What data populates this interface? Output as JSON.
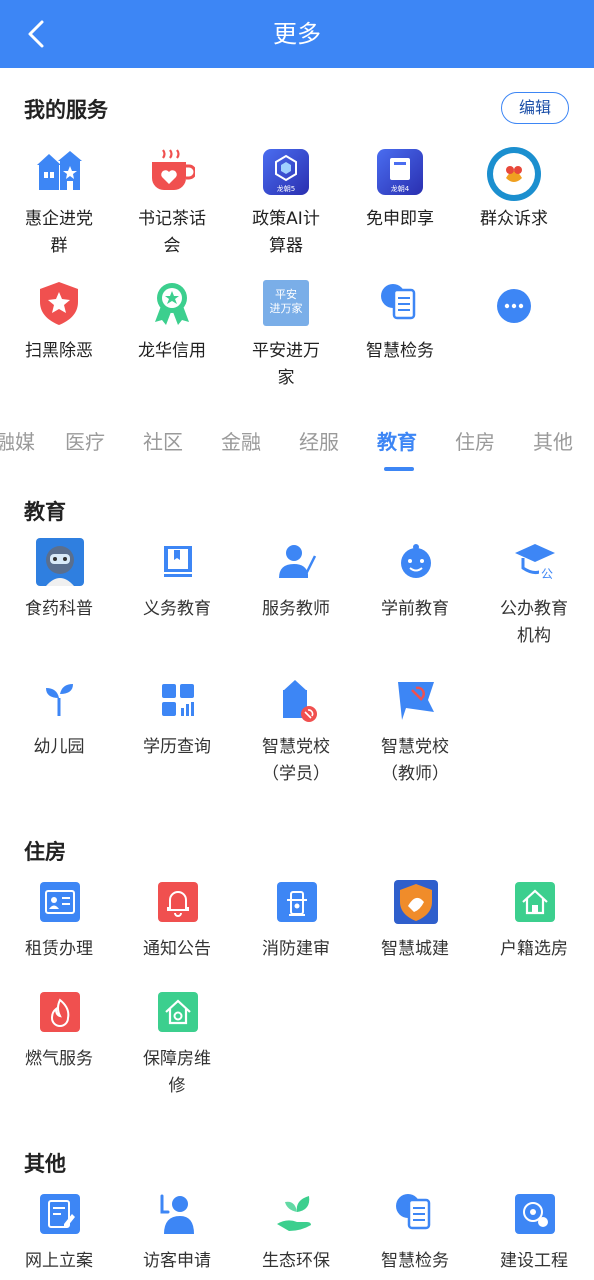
{
  "header": {
    "title": "更多",
    "back_icon": "chevron-left-icon"
  },
  "my_services": {
    "title": "我的服务",
    "edit_label": "编辑",
    "items": [
      {
        "label": "惠企进党\n群",
        "icon": "building-flag-icon"
      },
      {
        "label": "书记茶话\n会",
        "icon": "tea-cup-heart-icon"
      },
      {
        "label": "政策AI计\n算器",
        "icon": "cube-5-icon"
      },
      {
        "label": "免申即享",
        "icon": "book-4-icon"
      },
      {
        "label": "群众诉求",
        "icon": "circle-badge-icon"
      },
      {
        "label": "扫黑除恶",
        "icon": "shield-star-icon"
      },
      {
        "label": "龙华信用",
        "icon": "medal-star-icon"
      },
      {
        "label": "平安进万\n家",
        "icon": "ping-an-tile-icon",
        "tile_text": "平安\n进万家"
      },
      {
        "label": "智慧检务",
        "icon": "document-stack-icon"
      },
      {
        "label": "",
        "icon": "more-dots-icon"
      }
    ]
  },
  "categories": {
    "items": [
      "融媒",
      "医疗",
      "社区",
      "金融",
      "经服",
      "教育",
      "住房",
      "其他"
    ],
    "active": "教育"
  },
  "sections": [
    {
      "title": "教育",
      "items": [
        {
          "label": "食药科普",
          "icon": "robot-avatar-icon"
        },
        {
          "label": "义务教育",
          "icon": "book-icon"
        },
        {
          "label": "服务教师",
          "icon": "teacher-icon"
        },
        {
          "label": "学前教育",
          "icon": "baby-face-icon"
        },
        {
          "label": "公办教育\n机构",
          "icon": "graduation-cap-icon"
        },
        {
          "label": "幼儿园",
          "icon": "sprout-icon"
        },
        {
          "label": "学历查询",
          "icon": "qr-chart-icon"
        },
        {
          "label": "智慧党校\n（学员）",
          "icon": "party-school-student-icon"
        },
        {
          "label": "智慧党校\n（教师）",
          "icon": "party-flag-icon"
        }
      ]
    },
    {
      "title": "住房",
      "items": [
        {
          "label": "租赁办理",
          "icon": "id-card-icon"
        },
        {
          "label": "通知公告",
          "icon": "bell-icon"
        },
        {
          "label": "消防建审",
          "icon": "hydrant-icon"
        },
        {
          "label": "智慧城建",
          "icon": "shield-city-icon"
        },
        {
          "label": "户籍选房",
          "icon": "house-icon"
        },
        {
          "label": "燃气服务",
          "icon": "flame-icon"
        },
        {
          "label": "保障房维\n修",
          "icon": "house-shield-icon"
        }
      ]
    },
    {
      "title": "其他",
      "items": [
        {
          "label": "网上立案",
          "icon": "edit-doc-icon"
        },
        {
          "label": "访客申请",
          "icon": "visitor-icon"
        },
        {
          "label": "生态环保",
          "icon": "hand-leaf-icon"
        },
        {
          "label": "智慧检务",
          "icon": "document-stack-icon"
        },
        {
          "label": "建设工程",
          "icon": "construction-icon"
        }
      ]
    }
  ],
  "colors": {
    "primary": "#3d86f5",
    "red": "#f0504f",
    "green": "#3ccf8e",
    "orange": "#f08c2a"
  }
}
